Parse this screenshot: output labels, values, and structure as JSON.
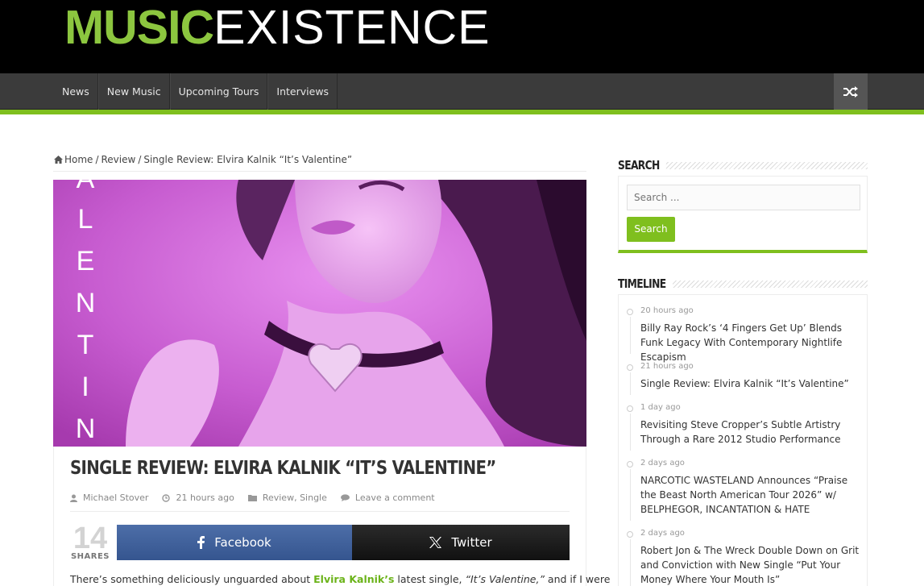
{
  "header": {
    "logo_part1": "MUSIC",
    "logo_part2": "EXISTENCE"
  },
  "nav": {
    "items": [
      {
        "label": "News"
      },
      {
        "label": "New Music"
      },
      {
        "label": "Upcoming Tours"
      },
      {
        "label": "Interviews"
      }
    ],
    "shuffle_icon": "shuffle-icon"
  },
  "breadcrumb": {
    "home": "Home",
    "sep1": "/",
    "category": "Review",
    "sep2": "/",
    "current": "Single Review: Elvira Kalnik “It’s Valentine”"
  },
  "article": {
    "hero_text": "VALENTINE",
    "title": "SINGLE REVIEW: ELVIRA KALNIK “IT’S VALENTINE”",
    "author": "Michael Stover",
    "time": "21 hours ago",
    "categories": "Review, Single",
    "comments": "Leave a comment",
    "shares_count": "14",
    "shares_label": "SHARES",
    "facebook_label": "Facebook",
    "twitter_label": "Twitter",
    "body_start": "There’s something deliciously unguarded about ",
    "body_artist": "Elvira Kalnik’s",
    "body_mid": " latest single, ",
    "body_song": "“It’s Valentine,”",
    "body_end": " and if I were"
  },
  "sidebar": {
    "search": {
      "title": "SEARCH",
      "placeholder": "Search ...",
      "button": "Search"
    },
    "timeline": {
      "title": "TIMELINE",
      "items": [
        {
          "time": "20 hours ago",
          "title": "Billy Ray Rock’s ‘4 Fingers Get Up’ Blends Funk Legacy With Contemporary Nightlife Escapism"
        },
        {
          "time": "21 hours ago",
          "title": "Single Review: Elvira Kalnik “It’s Valentine”"
        },
        {
          "time": "1 day ago",
          "title": "Revisiting Steve Cropper’s Subtle Artistry Through a Rare 2012 Studio Performance"
        },
        {
          "time": "2 days ago",
          "title": "NARCOTIC WASTELAND Announces “Praise the Beast North American Tour 2026” w/ BELPHEGOR, INCANTATION & HATE"
        },
        {
          "time": "2 days ago",
          "title": "Robert Jon & The Wreck Double Down on Grit and Conviction with New Single “Put Your Money Where Your Mouth Is”"
        }
      ]
    }
  },
  "colors": {
    "accent": "#7fbf1e",
    "logo_green": "#8cc63f",
    "facebook": "#3b5998",
    "twitter": "#1a1a1a",
    "hero_tint": "#d060d8"
  }
}
